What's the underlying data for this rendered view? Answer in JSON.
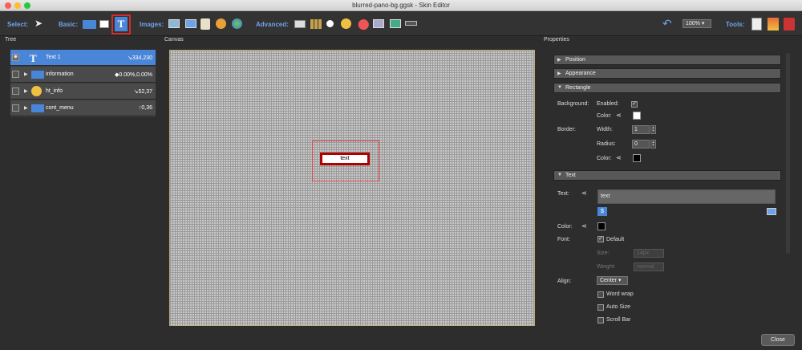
{
  "window": {
    "title": "blurred-pano-bg.ggsk - Skin Editor"
  },
  "toolbar": {
    "select_label": "Select:",
    "basic_label": "Basic:",
    "images_label": "Images:",
    "advanced_label": "Advanced:",
    "tools_label": "Tools:",
    "zoom_value": "100%"
  },
  "panels": {
    "tree": "Tree",
    "canvas": "Canvas",
    "properties": "Properties"
  },
  "tree": {
    "items": [
      {
        "name": "Text 1",
        "pos": "↘334,230",
        "icon": "text-icon"
      },
      {
        "name": "information",
        "pos": "◆0.00%,0.00%",
        "icon": "folder-icon"
      },
      {
        "name": "ht_info",
        "pos": "↘52,37",
        "icon": "hotspot-icon"
      },
      {
        "name": "cont_menu",
        "pos": "↑0,36",
        "icon": "folder-icon"
      }
    ]
  },
  "canvas": {
    "element_text": "text"
  },
  "properties": {
    "sections": [
      "Position",
      "Appearance",
      "Rectangle",
      "Text"
    ],
    "rectangle": {
      "background_label": "Background:",
      "enabled_label": "Enabled:",
      "enabled_check": "✓",
      "color_label": "Color:",
      "border_label": "Border:",
      "width_label": "Width:",
      "width_value": "1",
      "radius_label": "Radius:",
      "radius_value": "0",
      "border_color_label": "Color:"
    },
    "text": {
      "text_label": "Text:",
      "text_value": "text",
      "color_label": "Color:",
      "font_label": "Font:",
      "default_label": "Default",
      "default_check": "✓",
      "size_label": "Size:",
      "size_value": "14px",
      "weight_label": "Weight:",
      "weight_value": "normal",
      "align_label": "Align:",
      "align_value": "Center",
      "wordwrap_label": "Word wrap",
      "autosize_label": "Auto Size",
      "scrollbar_label": "Scroll Bar",
      "variable_symbol": "$"
    }
  },
  "footer": {
    "close_label": "Close"
  }
}
